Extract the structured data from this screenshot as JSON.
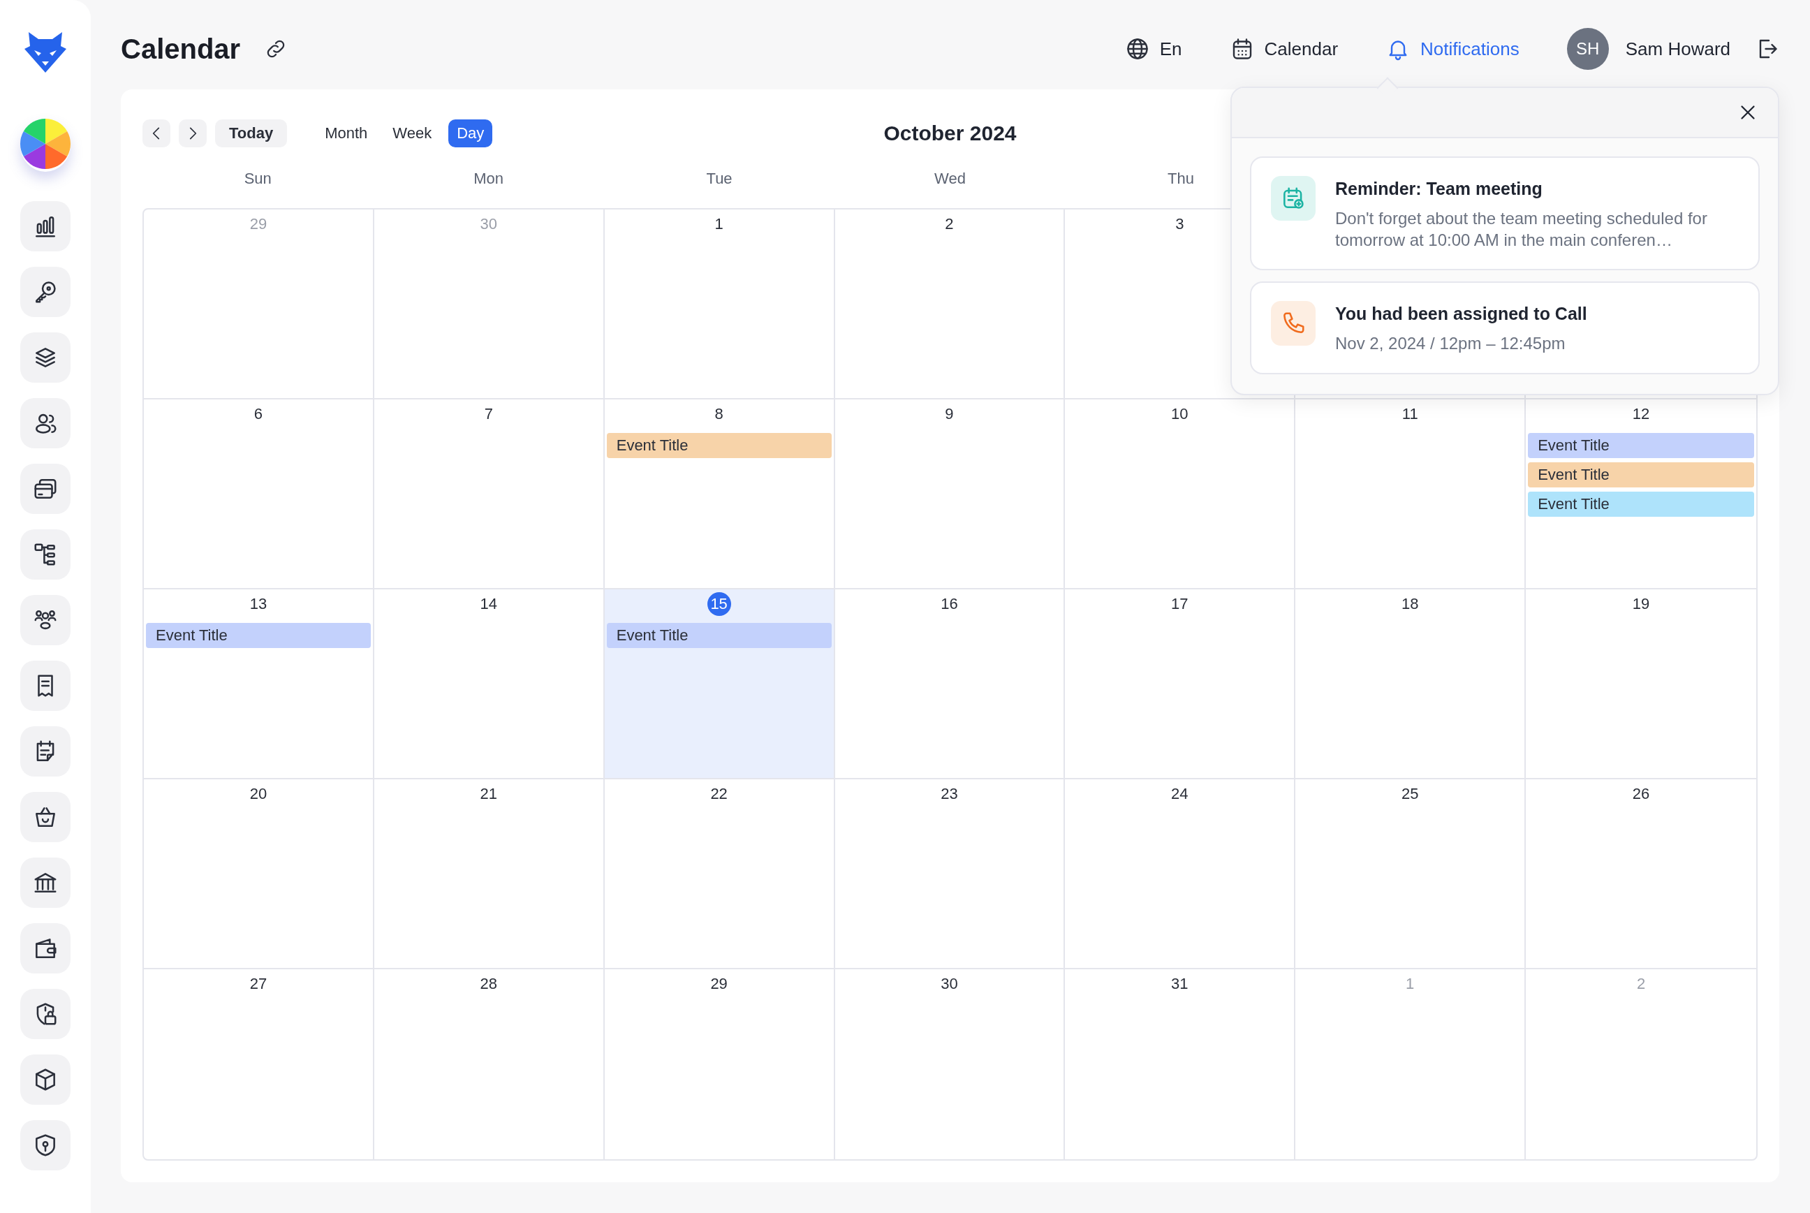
{
  "page": {
    "title": "Calendar"
  },
  "nav": [
    {
      "kind": "language",
      "label": "En",
      "selected": false
    },
    {
      "kind": "calendar",
      "label": "Calendar",
      "selected": false
    },
    {
      "kind": "notifications",
      "label": "Notifications",
      "selected": true
    }
  ],
  "user": {
    "initials": "SH",
    "name": "Sam Howard"
  },
  "toolbar": {
    "today": "Today",
    "period": "October 2024",
    "views": [
      {
        "label": "Month",
        "selected": false
      },
      {
        "label": "Week",
        "selected": false
      },
      {
        "label": "Day",
        "selected": true
      }
    ]
  },
  "weekdays": [
    "Sun",
    "Mon",
    "Tue",
    "Wed",
    "Thu"
  ],
  "weeks": [
    {
      "days": [
        {
          "day": "29",
          "muted": true,
          "today": false
        },
        {
          "day": "30",
          "muted": true,
          "today": false
        },
        {
          "day": "1",
          "muted": false,
          "today": false
        },
        {
          "day": "2",
          "muted": false,
          "today": false
        },
        {
          "day": "3",
          "muted": false,
          "today": false
        }
      ]
    },
    {
      "days": [
        {
          "day": "6",
          "muted": false,
          "today": false
        },
        {
          "day": "7",
          "muted": false,
          "today": false
        },
        {
          "day": "8",
          "muted": false,
          "today": false,
          "events": [
            {
              "title": "Event Title",
              "color": "#f7d3a9"
            }
          ]
        },
        {
          "day": "9",
          "muted": false,
          "today": false
        },
        {
          "day": "10",
          "muted": false,
          "today": false
        },
        {
          "day": "11",
          "muted": false,
          "today": false
        },
        {
          "day": "12",
          "muted": false,
          "today": false,
          "events": [
            {
              "title": "Event Title",
              "color": "#c3d1fc"
            },
            {
              "title": "Event Title",
              "color": "#f7d3a9"
            },
            {
              "title": "Event Title",
              "color": "#aee3fb"
            }
          ]
        }
      ]
    },
    {
      "days": [
        {
          "day": "13",
          "muted": false,
          "today": false,
          "events": [
            {
              "title": "Event Title",
              "color": "#c3d1fc"
            }
          ]
        },
        {
          "day": "14",
          "muted": false,
          "today": false
        },
        {
          "day": "15",
          "muted": false,
          "today": true,
          "events": [
            {
              "title": "Event Title",
              "color": "#c3d1fc"
            }
          ]
        },
        {
          "day": "16",
          "muted": false,
          "today": false
        },
        {
          "day": "17",
          "muted": false,
          "today": false
        },
        {
          "day": "18",
          "muted": false,
          "today": false
        },
        {
          "day": "19",
          "muted": false,
          "today": false
        }
      ]
    },
    {
      "days": [
        {
          "day": "20",
          "muted": false,
          "today": false
        },
        {
          "day": "21",
          "muted": false,
          "today": false
        },
        {
          "day": "22",
          "muted": false,
          "today": false
        },
        {
          "day": "23",
          "muted": false,
          "today": false
        },
        {
          "day": "24",
          "muted": false,
          "today": false
        },
        {
          "day": "25",
          "muted": false,
          "today": false
        },
        {
          "day": "26",
          "muted": false,
          "today": false
        }
      ]
    },
    {
      "days": [
        {
          "day": "27",
          "muted": false,
          "today": false
        },
        {
          "day": "28",
          "muted": false,
          "today": false
        },
        {
          "day": "29",
          "muted": false,
          "today": false
        },
        {
          "day": "30",
          "muted": false,
          "today": false
        },
        {
          "day": "31",
          "muted": false,
          "today": false
        },
        {
          "day": "1",
          "muted": true,
          "today": false
        },
        {
          "day": "2",
          "muted": true,
          "today": false
        }
      ]
    }
  ],
  "notifications": {
    "items": [
      {
        "kind": "calendar",
        "title": "Reminder: Team meeting",
        "text": "Don't forget about the team meeting scheduled for tomorrow at 10:00 AM in the main conferen…"
      },
      {
        "kind": "call",
        "title": "You had been assigned to Call",
        "text": "Nov 2, 2024 / 12pm – 12:45pm"
      }
    ]
  }
}
